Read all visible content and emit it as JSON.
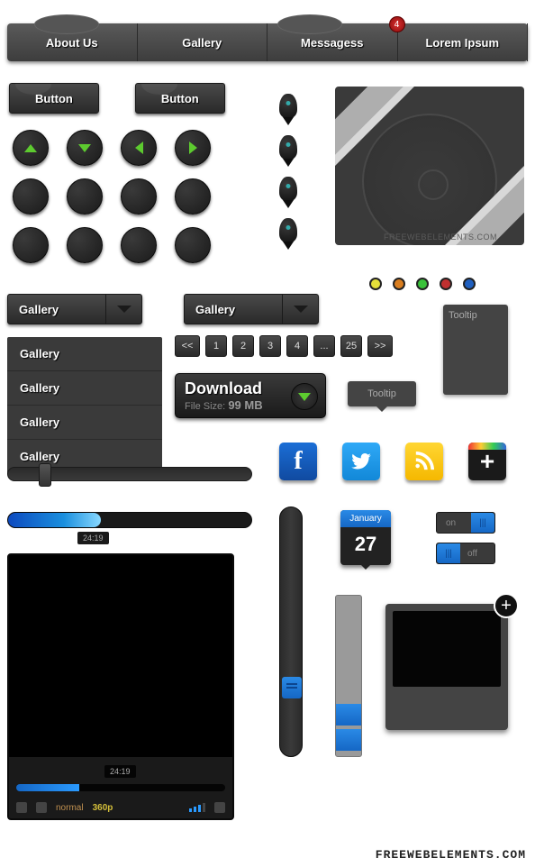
{
  "nav": {
    "tabs": [
      "About Us",
      "Gallery",
      "Messagess",
      "Lorem Ipsum"
    ],
    "badge": "4"
  },
  "buttons": {
    "a": "Button",
    "b": "Button"
  },
  "dropdown": {
    "a": "Gallery",
    "b": "Gallery"
  },
  "menu": {
    "items": [
      "Gallery",
      "Gallery",
      "Gallery",
      "Gallery"
    ]
  },
  "pagination": {
    "prev": "<<",
    "pages": [
      "1",
      "2",
      "3",
      "4",
      "...",
      "25"
    ],
    "next": ">>"
  },
  "download": {
    "title": "Download",
    "fs_label": "File Size:",
    "fs_value": "99 MB"
  },
  "tooltip": {
    "a": "Tooltip",
    "b": "Tooltip"
  },
  "album_watermark": "FREEWEBELEMENTS.COM",
  "progress_time": "24:19",
  "calendar": {
    "month": "January",
    "day": "27"
  },
  "toggle": {
    "on": "on",
    "off": "off"
  },
  "player": {
    "time": "24:19",
    "quality_label": "normal",
    "quality_value": "360p"
  },
  "colors": {
    "dots": [
      "#e5e03a",
      "#d97d1e",
      "#3ac23a",
      "#c03030",
      "#2060c0"
    ]
  },
  "footer": "FREEWEBELEMENTS.COM"
}
